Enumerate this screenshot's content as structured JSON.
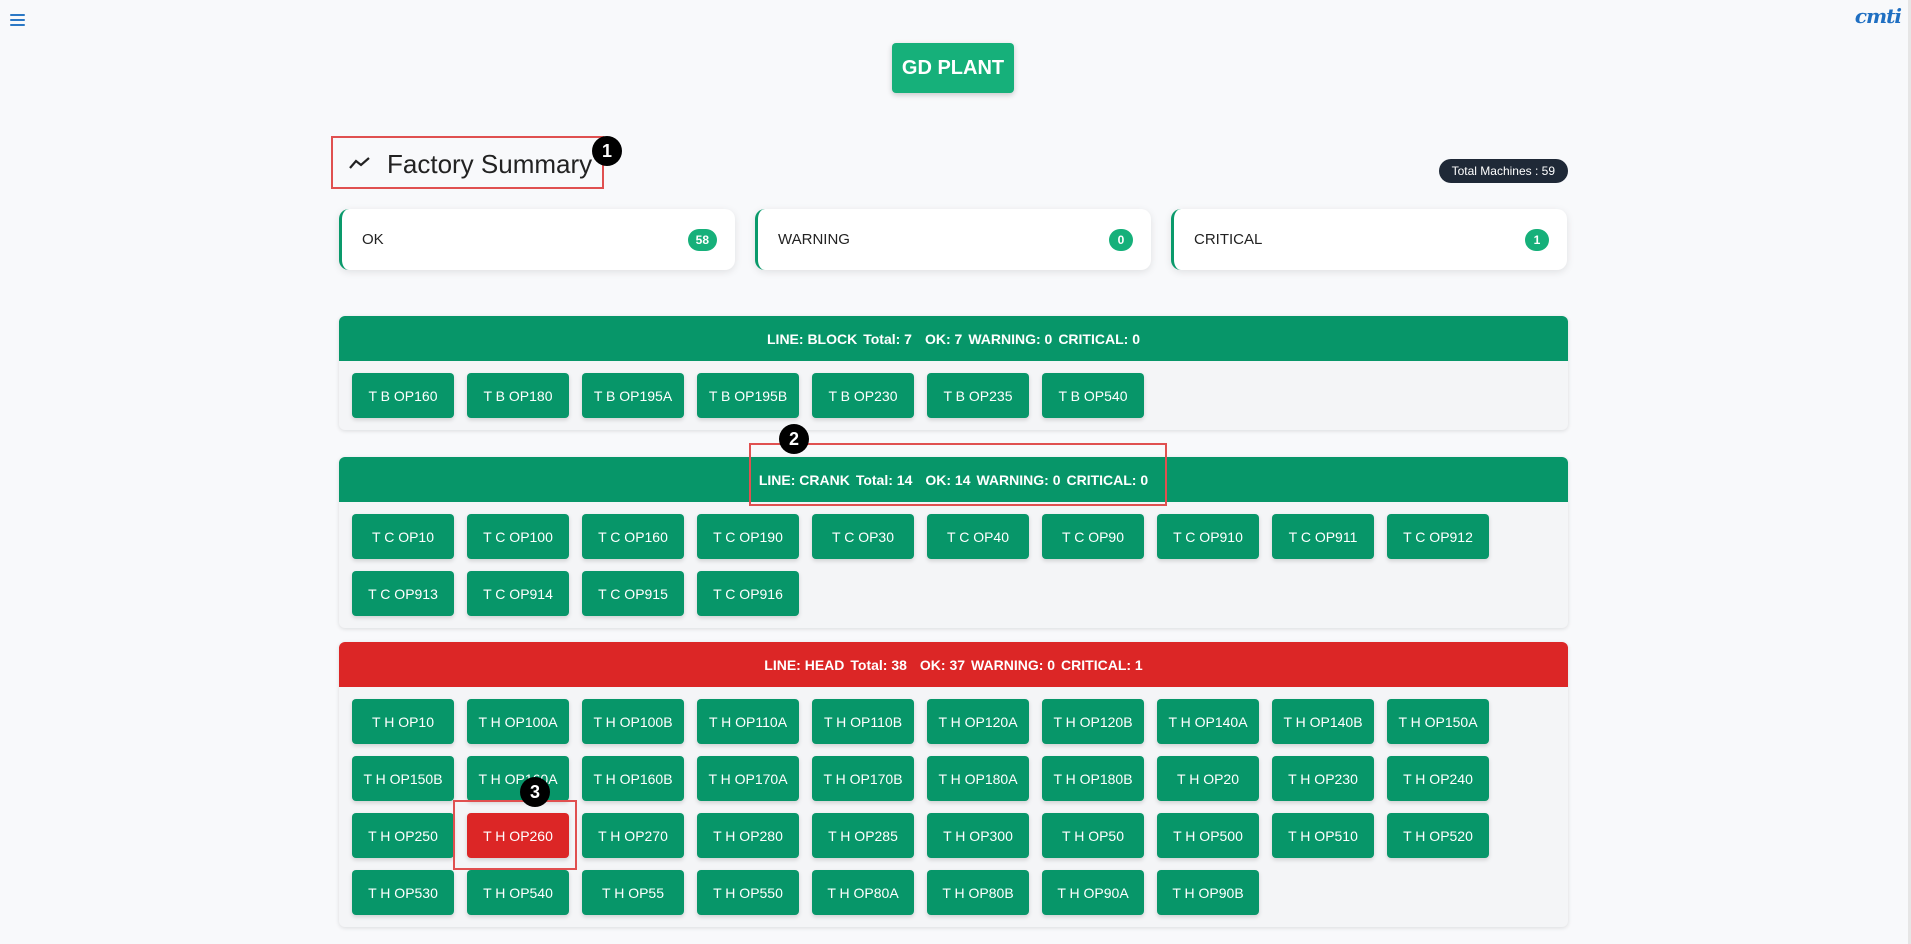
{
  "header": {
    "brand": "cmti",
    "plant_label": "GD PLANT"
  },
  "summary": {
    "title": "Factory Summary",
    "total_machines": "Total Machines : 59",
    "cards": [
      {
        "label": "OK",
        "count": "58"
      },
      {
        "label": "WARNING",
        "count": "0"
      },
      {
        "label": "CRITICAL",
        "count": "1"
      }
    ]
  },
  "markers": [
    "1",
    "2",
    "3"
  ],
  "lines": [
    {
      "line": "LINE: BLOCK",
      "total": "Total: 7",
      "ok": "OK: 7",
      "warning": "WARNING: 0",
      "critical": "CRITICAL: 0",
      "status": "ok",
      "machines": [
        "T B OP160",
        "T B OP180",
        "T B OP195A",
        "T B OP195B",
        "T B OP230",
        "T B OP235",
        "T B OP540"
      ]
    },
    {
      "line": "LINE: CRANK",
      "total": "Total: 14",
      "ok": "OK: 14",
      "warning": "WARNING: 0",
      "critical": "CRITICAL: 0",
      "status": "ok",
      "machines": [
        "T C OP10",
        "T C OP100",
        "T C OP160",
        "T C OP190",
        "T C OP30",
        "T C OP40",
        "T C OP90",
        "T C OP910",
        "T C OP911",
        "T C OP912",
        "T C OP913",
        "T C OP914",
        "T C OP915",
        "T C OP916"
      ]
    },
    {
      "line": "LINE: HEAD",
      "total": "Total: 38",
      "ok": "OK: 37",
      "warning": "WARNING: 0",
      "critical": "CRITICAL: 1",
      "status": "critical",
      "machines": [
        "T H OP10",
        "T H OP100A",
        "T H OP100B",
        "T H OP110A",
        "T H OP110B",
        "T H OP120A",
        "T H OP120B",
        "T H OP140A",
        "T H OP140B",
        "T H OP150A",
        "T H OP150B",
        "T H OP160A",
        "T H OP160B",
        "T H OP170A",
        "T H OP170B",
        "T H OP180A",
        "T H OP180B",
        "T H OP20",
        "T H OP230",
        "T H OP240",
        "T H OP250",
        "T H OP260",
        "T H OP270",
        "T H OP280",
        "T H OP285",
        "T H OP300",
        "T H OP50",
        "T H OP500",
        "T H OP510",
        "T H OP520",
        "T H OP530",
        "T H OP540",
        "T H OP55",
        "T H OP550",
        "T H OP80A",
        "T H OP80B",
        "T H OP90A",
        "T H OP90B"
      ],
      "critical_machines": [
        "T H OP260"
      ]
    }
  ]
}
